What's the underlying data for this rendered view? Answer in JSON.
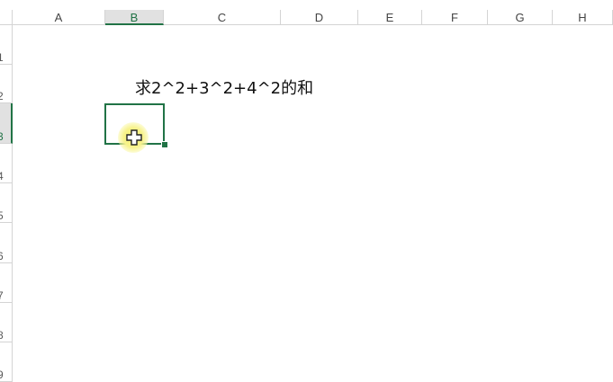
{
  "sheet": {
    "columns": [
      "A",
      "B",
      "C",
      "D",
      "E",
      "F",
      "G",
      "H"
    ],
    "selected_column": "B",
    "rows": [
      "1",
      "2",
      "3",
      "4",
      "5",
      "6",
      "7",
      "8",
      "9"
    ],
    "selected_row": "3",
    "cells": {
      "B2": "求2^2+3^2+4^2的和"
    },
    "active_cell": "B3",
    "accent_color": "#217346"
  },
  "cursor": {
    "icon": "cell-select-cross-icon"
  }
}
